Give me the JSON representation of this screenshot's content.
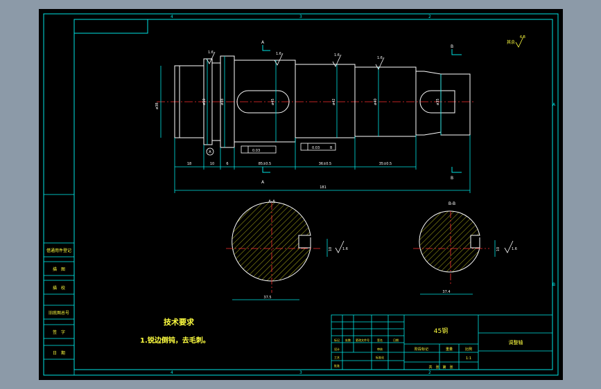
{
  "drawing": {
    "colors": {
      "border": "#00e5e5",
      "outline": "#ffffff",
      "dimension": "#00e5e5",
      "center_line": "#ff3030",
      "hatch": "#e8e820",
      "text": "#ffff40",
      "cutting_plane": "#ff4040"
    },
    "zone_marks": {
      "top": [
        "4",
        "3",
        "2"
      ],
      "bottom": [
        "4",
        "3",
        "2"
      ],
      "right": [
        "A",
        "B"
      ]
    },
    "views": {
      "section_a_mark": "A",
      "section_b_mark": "B",
      "section_aa_label": "A-A",
      "section_bb_label": "B-B"
    },
    "dims": {
      "d1": "ø38",
      "d2": "ø50",
      "d3": "ø48",
      "d4": "ø45",
      "d5": "ø42",
      "d6": "ø40",
      "d7": "ø35",
      "len1": "18",
      "len2": "10",
      "len3": "6",
      "len4": "85±0.5",
      "len5": "36±0.5",
      "len6": "35±0.5",
      "total": "181",
      "aa_width": "37.5",
      "bb_width": "37.4",
      "aa_key": "10",
      "bb_key": "10"
    },
    "roughness": {
      "r1": "1.6",
      "r2": "1.6",
      "r3": "1.6",
      "r4": "1.6",
      "other": "其余",
      "other_value": "6.3",
      "aa_key": "1.6",
      "bb_key": "1.6"
    },
    "tolerances": {
      "t1": "0.03",
      "t2": "0.03",
      "datum_a": "A",
      "datum_b": "B"
    },
    "tech_req": {
      "title": "技术要求",
      "item1": "1.锐边倒钝，去毛刺。"
    },
    "left_column": [
      "借通用件登记",
      "描　图",
      "描　校",
      "旧底图总号",
      "签　字",
      "日　期"
    ],
    "title_block": {
      "material": "45钢",
      "part_name": "调整轴",
      "scale_label": "比例",
      "scale_value": "1:1",
      "weight_label": "重量",
      "stage_label": "阶段标记",
      "labels": [
        "标记",
        "处数",
        "更改文件号",
        "签名",
        "日期",
        "设计",
        "审核",
        "工艺",
        "标准化",
        "批准"
      ],
      "sheet": "共　张　第　张"
    }
  }
}
